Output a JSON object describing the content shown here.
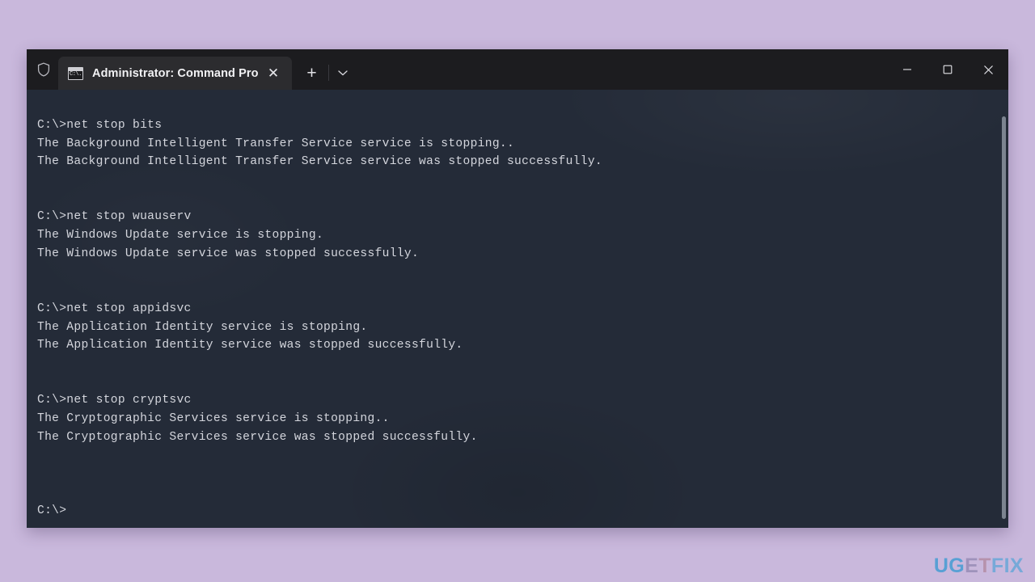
{
  "window": {
    "title": "Administrator: Command Pro",
    "shield_icon": "shield-icon",
    "tab_icon": "command-prompt-icon",
    "tab_icon_glyph": "C:\\.",
    "close_tab_label": "✕",
    "new_tab_label": "+",
    "dropdown_label": "chevron-down-icon",
    "minimize_label": "minimize-icon",
    "maximize_label": "maximize-icon",
    "close_label": "close-icon"
  },
  "console": {
    "lines": [
      "C:\\>net stop bits",
      "The Background Intelligent Transfer Service service is stopping..",
      "The Background Intelligent Transfer Service service was stopped successfully.",
      "",
      "",
      "C:\\>net stop wuauserv",
      "The Windows Update service is stopping.",
      "The Windows Update service was stopped successfully.",
      "",
      "",
      "C:\\>net stop appidsvc",
      "The Application Identity service is stopping.",
      "The Application Identity service was stopped successfully.",
      "",
      "",
      "C:\\>net stop cryptsvc",
      "The Cryptographic Services service is stopping..",
      "The Cryptographic Services service was stopped successfully.",
      "",
      "",
      "",
      "C:\\>"
    ],
    "prompt": "C:\\>",
    "text_color": "#d4d6dd",
    "background_color": "#242b38"
  },
  "watermark": {
    "part1": "UG",
    "part2": "E",
    "part3": "T",
    "part4": "FIX",
    "full": "UGETFIX"
  },
  "colors": {
    "page_background": "#c9b8dc",
    "titlebar": "#1c1c1f",
    "tab_active": "#2c2c2f",
    "terminal_bg": "#242b38",
    "scrollbar_thumb": "#9aa3ad"
  }
}
